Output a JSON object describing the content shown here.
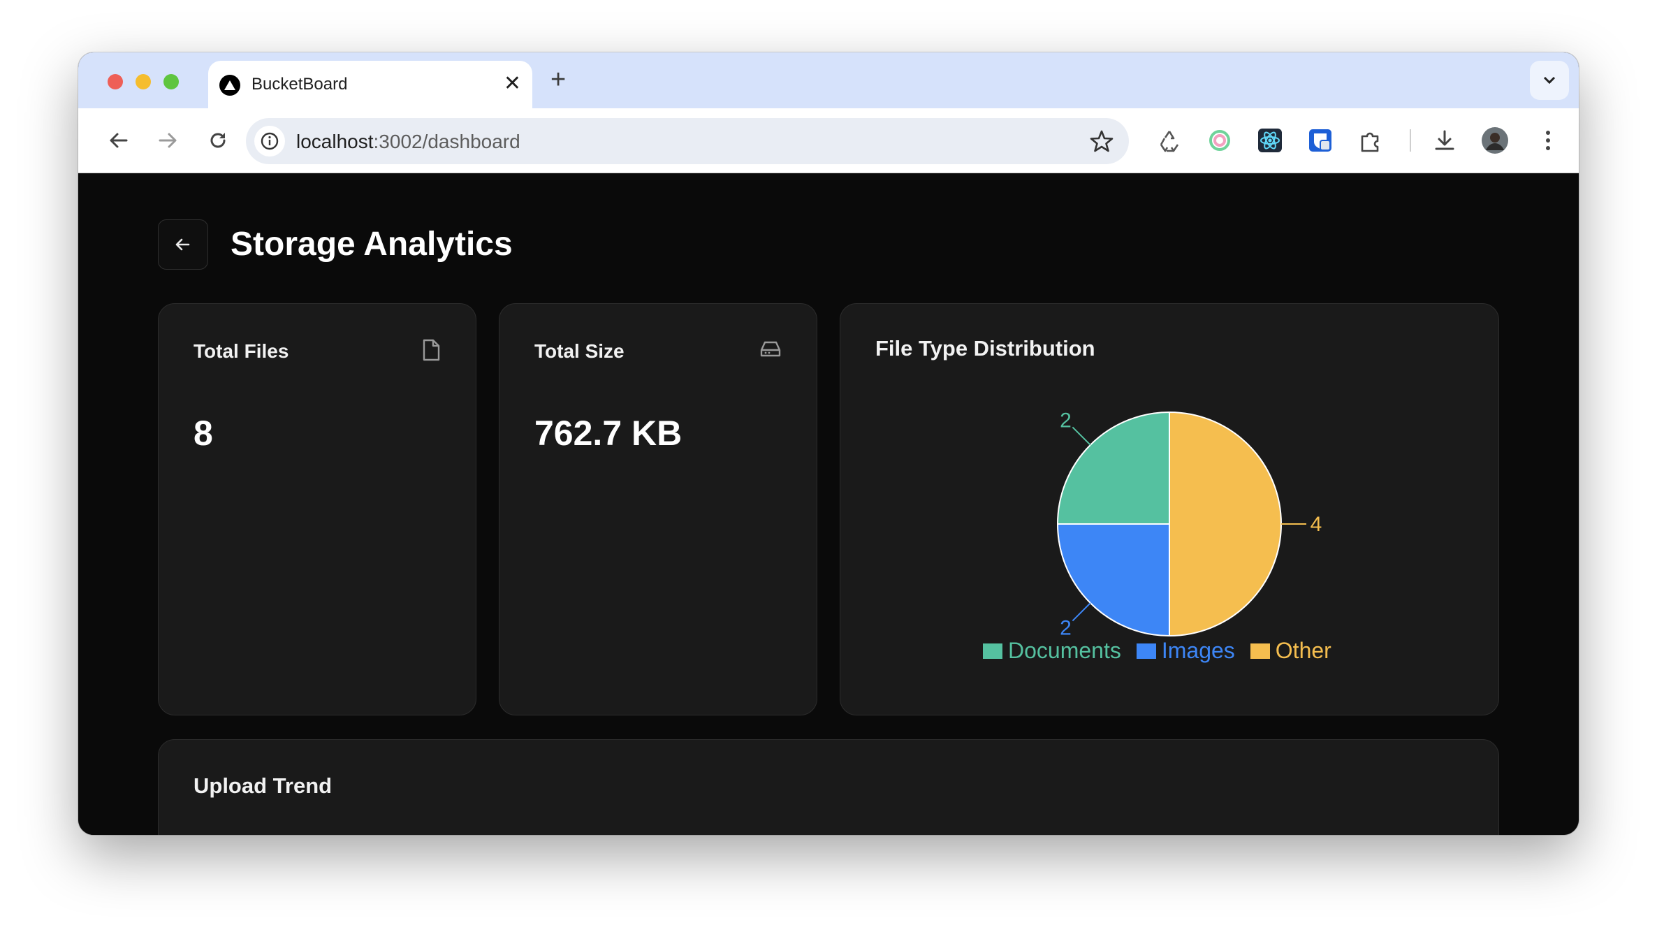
{
  "browser": {
    "tab_title": "BucketBoard",
    "url_host": "localhost",
    "url_path": ":3002/dashboard",
    "close_glyph": "✕",
    "new_tab_glyph": "+"
  },
  "page": {
    "title": "Storage Analytics"
  },
  "cards": {
    "total_files": {
      "title": "Total Files",
      "value": "8",
      "icon": "file-icon"
    },
    "total_size": {
      "title": "Total Size",
      "value": "762.7 KB",
      "icon": "hard-drive-icon"
    },
    "distribution": {
      "title": "File Type Distribution"
    },
    "upload_trend": {
      "title": "Upload Trend"
    }
  },
  "chart_data": {
    "type": "pie",
    "title": "File Type Distribution",
    "slices": [
      {
        "name": "Documents",
        "value": 2,
        "color": "#55c1a0"
      },
      {
        "name": "Images",
        "value": 2,
        "color": "#3d86f6"
      },
      {
        "name": "Other",
        "value": 4,
        "color": "#f5be4f"
      }
    ],
    "legend_position": "bottom"
  }
}
